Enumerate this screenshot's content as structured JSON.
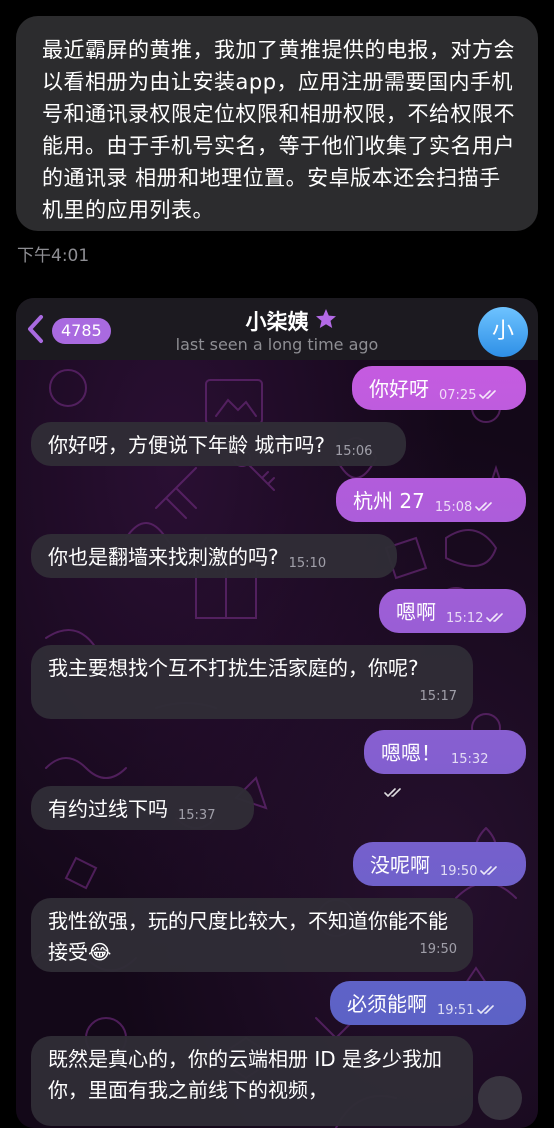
{
  "outer_message": {
    "text": "最近霸屏的黄推，我加了黄推提供的电报，对方会以看相册为由让安装app，应用注册需要国内手机号和通讯录权限定位权限和相册权限，不给权限不能用。由于手机号实名，等于他们收集了实名用户的通讯录 相册和地理位置。安卓版本还会扫描手机里的应用列表。",
    "time": "下午4:01"
  },
  "chat": {
    "back_badge": "4785",
    "title": "小柒姨",
    "status": "last seen a long time ago",
    "avatar_letter": "小",
    "messages": [
      {
        "dir": "out",
        "text": "你好呀",
        "time": "07:25"
      },
      {
        "dir": "in",
        "text": "你好呀，方便说下年龄 城市吗?",
        "time": "15:06"
      },
      {
        "dir": "out",
        "text": "杭州 27",
        "time": "15:08"
      },
      {
        "dir": "in",
        "text": "你也是翻墙来找刺激的吗?",
        "time": "15:10"
      },
      {
        "dir": "out",
        "text": "嗯啊",
        "time": "15:12"
      },
      {
        "dir": "in",
        "text": "我主要想找个互不打扰生活家庭的，你呢?",
        "time": "15:17"
      },
      {
        "dir": "out",
        "text": "嗯嗯！",
        "time": "15:32"
      },
      {
        "dir": "in",
        "text": "有约过线下吗",
        "time": "15:37"
      },
      {
        "dir": "out",
        "text": "没呢啊",
        "time": "19:50"
      },
      {
        "dir": "in",
        "text": "我性欲强，玩的尺度比较大，不知道你能不能接受😂",
        "time": "19:50"
      },
      {
        "dir": "out",
        "text": "必须能啊",
        "time": "19:51"
      },
      {
        "dir": "in",
        "text": "既然是真心的，你的云端相册 ID 是多少我加你，里面有我之前线下的视频，",
        "time": ""
      }
    ]
  },
  "colors": {
    "accent": "#a96ae0",
    "out_bubble_gradient_top": "#c65be0",
    "out_bubble_gradient_bottom": "#5c62c6",
    "in_bubble": "#302c36",
    "background": "#000000"
  },
  "icons": [
    "back-chevron-icon",
    "star-icon",
    "double-check-icon",
    "scroll-down-icon"
  ]
}
